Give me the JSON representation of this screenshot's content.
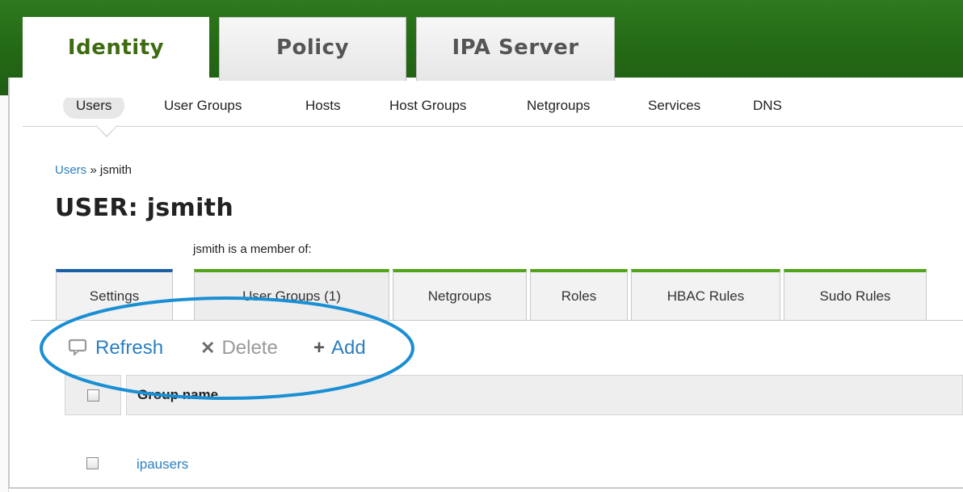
{
  "main_tabs": [
    {
      "label": "Identity",
      "active": true
    },
    {
      "label": "Policy",
      "active": false
    },
    {
      "label": "IPA Server",
      "active": false
    }
  ],
  "subnav": [
    {
      "label": "Users",
      "active": true
    },
    {
      "label": "User Groups"
    },
    {
      "label": "Hosts"
    },
    {
      "label": "Host Groups"
    },
    {
      "label": "Netgroups"
    },
    {
      "label": "Services"
    },
    {
      "label": "DNS"
    }
  ],
  "breadcrumb": {
    "link": "Users",
    "separator": " » ",
    "current": "jsmith"
  },
  "page_title": "USER: jsmith",
  "member_of_label": "jsmith is a member of:",
  "facet_tabs": [
    {
      "label": "Settings"
    },
    {
      "label": "User Groups (1)",
      "active": true
    },
    {
      "label": "Netgroups"
    },
    {
      "label": "Roles"
    },
    {
      "label": "HBAC Rules"
    },
    {
      "label": "Sudo Rules"
    }
  ],
  "actions": {
    "refresh": "Refresh",
    "delete": "Delete",
    "add": "Add",
    "refresh_icon": "refresh-icon",
    "delete_icon": "x-icon",
    "add_icon": "plus-icon"
  },
  "table": {
    "header": "Group name",
    "rows": [
      {
        "name": "ipausers"
      }
    ]
  },
  "colors": {
    "brand_green": "#2f7a1e",
    "link_blue": "#2a7fc1",
    "annotation_blue": "#1a8fd3",
    "facet_green": "#52a41d",
    "facet_blue": "#1d5fa6"
  }
}
